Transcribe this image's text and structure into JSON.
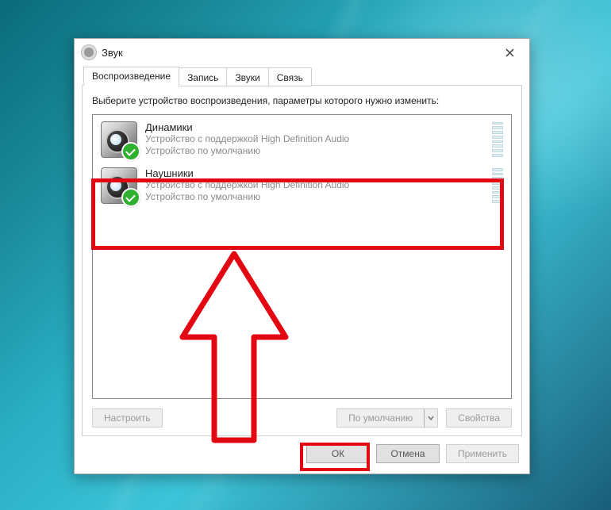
{
  "window": {
    "title": "Звук"
  },
  "tabs": [
    {
      "id": "playback",
      "label": "Воспроизведение",
      "active": true
    },
    {
      "id": "record",
      "label": "Запись"
    },
    {
      "id": "sounds",
      "label": "Звуки"
    },
    {
      "id": "comms",
      "label": "Связь"
    }
  ],
  "instruction": "Выберите устройство воспроизведения, параметры которого нужно изменить:",
  "devices": [
    {
      "name": "Динамики",
      "desc": "Устройство с поддержкой High Definition Audio",
      "status": "Устройство по умолчанию",
      "default": true
    },
    {
      "name": "Наушники",
      "desc": "Устройство с поддержкой High Definition Audio",
      "status": "Устройство по умолчанию",
      "default": true,
      "highlighted": true
    }
  ],
  "buttons": {
    "configure": "Настроить",
    "setdefault": "По умолчанию",
    "properties": "Свойства",
    "ok": "ОК",
    "cancel": "Отмена",
    "apply": "Применить"
  },
  "annotation": {
    "color": "#e30613",
    "highlight_device_index": 1,
    "highlight_footer_button": "ok"
  }
}
